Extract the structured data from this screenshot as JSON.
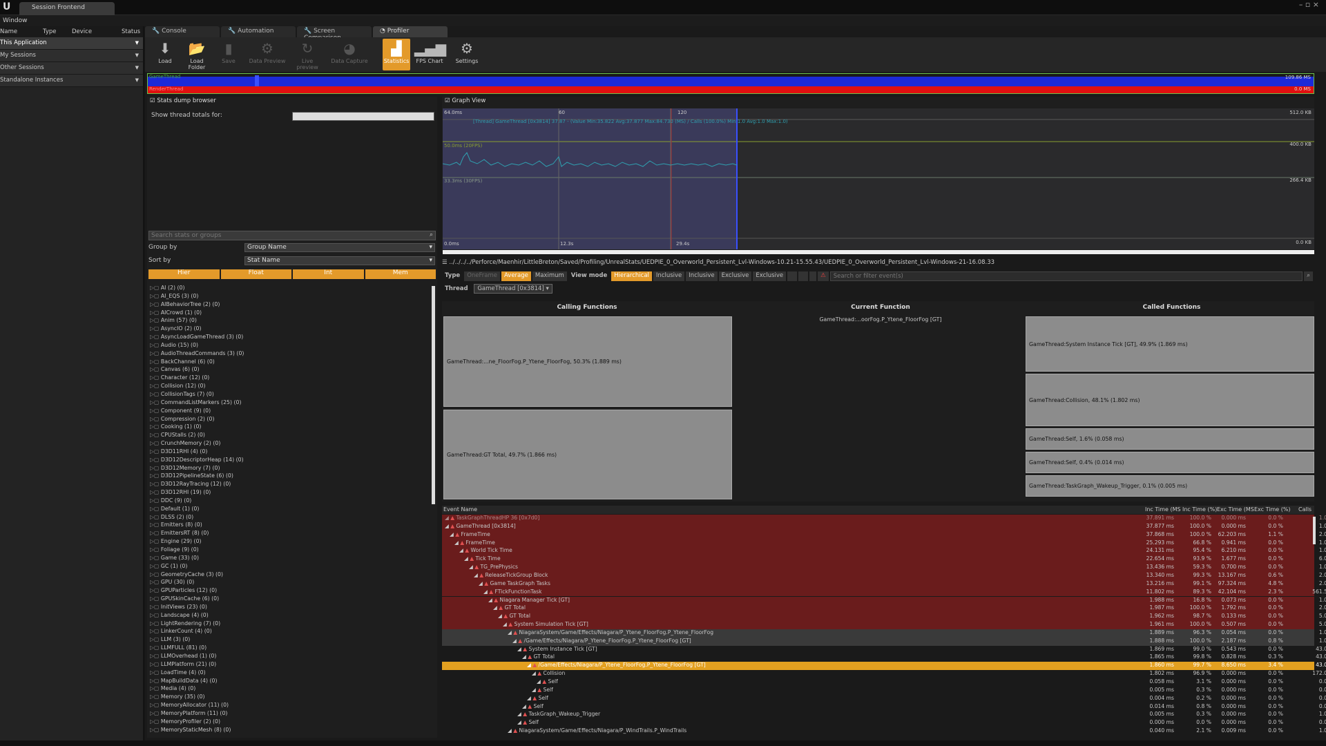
{
  "window": {
    "tab": "Session Frontend",
    "menu": "Window",
    "controls": "– ▫ ×"
  },
  "left": {
    "headers": [
      "Name",
      "Type",
      "Device",
      "Status"
    ],
    "rows": [
      "This Application",
      "My Sessions",
      "Other Sessions",
      "Standalone Instances"
    ]
  },
  "tabs": [
    "Console",
    "Automation",
    "Screen Comparison",
    "Profiler"
  ],
  "toolbar": [
    "Load",
    "Load Folder",
    "Save",
    "Data Preview",
    "Live preview",
    "Data Capture",
    "Statistics",
    "FPS Chart",
    "Settings"
  ],
  "timeline": {
    "label1": "GameThread",
    "label2": "RenderThread",
    "val1": "109.86 MS",
    "val2": "0.0 MS"
  },
  "stats": {
    "header": "Stats dump browser",
    "show_thread": "Show thread totals for:",
    "search_placeholder": "Search stats or groups",
    "group_by_label": "Group by",
    "group_by_value": "Group Name",
    "sort_by_label": "Sort by",
    "sort_by_value": "Stat Name",
    "filters": [
      "Hier",
      "Float",
      "Int",
      "Mem"
    ],
    "groups": [
      "AI (2) (0)",
      "AI_EQS (3) (0)",
      "AIBehaviorTree (2) (0)",
      "AICrowd (1) (0)",
      "Anim (57) (0)",
      "AsyncIO (2) (0)",
      "AsyncLoadGameThread (3) (0)",
      "Audio (15) (0)",
      "AudioThreadCommands (3) (0)",
      "BackChannel (6) (0)",
      "Canvas (6) (0)",
      "Character (12) (0)",
      "Collision (12) (0)",
      "CollisionTags (7) (0)",
      "CommandListMarkers (25) (0)",
      "Component (9) (0)",
      "Compression (2) (0)",
      "Cooking (1) (0)",
      "CPUStalls (2) (0)",
      "CrunchMemory (2) (0)",
      "D3D11RHI (4) (0)",
      "D3D12DescriptorHeap (14) (0)",
      "D3D12Memory (7) (0)",
      "D3D12PipelineState (6) (0)",
      "D3D12RayTracing (12) (0)",
      "D3D12RHI (19) (0)",
      "DDC (9) (0)",
      "Default (1) (0)",
      "DLSS (2) (0)",
      "Emitters (8) (0)",
      "EmittersRT (8) (0)",
      "Engine (29) (0)",
      "Foliage (9) (0)",
      "Game (33) (0)",
      "GC (1) (0)",
      "GeometryCache (3) (0)",
      "GPU (30) (0)",
      "GPUParticles (12) (0)",
      "GPUSkinCache (6) (0)",
      "InitViews (23) (0)",
      "Landscape (4) (0)",
      "LightRendering (7) (0)",
      "LinkerCount (4) (0)",
      "LLM (3) (0)",
      "LLMFULL (81) (0)",
      "LLMOverhead (1) (0)",
      "LLMPlatform (21) (0)",
      "LoadTime (4) (0)",
      "MapBuildData (4) (0)",
      "Media (4) (0)",
      "Memory (35) (0)",
      "MemoryAllocator (11) (0)",
      "MemoryPlatform (11) (0)",
      "MemoryProfiler (2) (0)",
      "MemoryStaticMesh (8) (0)"
    ]
  },
  "graph": {
    "header": "Graph View",
    "top_ms": "64.0ms",
    "x1": "60",
    "x2": "120",
    "r1": "512.0 KB",
    "r2": "400.0 KB",
    "r3": "266.4 KB",
    "r4": "0.0 KB",
    "fps1": "50.0ms (20FPS)",
    "fps2": "33.3ms (30FPS)",
    "bottom": "0.0ms",
    "t1": "12.3s",
    "t2": "29.4s",
    "legend": "[Thread] GameThread [0x3814] 37.87 - (Value Min:35.822 Avg:37.877 Max:84.730 (MS) / Calls (100.0%) Min:1.0 Avg:1.0 Max:1.0)"
  },
  "path": "../../../../Perforce/Maenhir/LittleBreton/Saved/Profiling/UnrealStats/UEDPIE_0_Overworld_Persistent_Lvl-Windows-10.21-15.55.43/UEDPIE_0_Overworld_Persistent_Lvl-Windows-21-16.08.33",
  "typebar": {
    "type": "Type",
    "oneframe": "OneFrame",
    "average": "Average",
    "maximum": "Maximum",
    "viewmode": "View mode",
    "hier": "Hierarchical",
    "b1": "Inclusive",
    "b2": "Inclusive",
    "b3": "Exclusive",
    "b4": "Exclusive",
    "search": "Search or filter event(s)",
    "thread": "Thread",
    "thread_value": "GameThread [0x3814]"
  },
  "callgraph": {
    "calling_hdr": "Calling Functions",
    "current_hdr": "Current Function",
    "called_hdr": "Called Functions",
    "current": "GameThread:...oorFog.P_Ytene_FloorFog [GT]",
    "calling": [
      "GameThread:...ne_FloorFog.P_Ytene_FloorFog, 50.3% (1.889 ms)",
      "GameThread:GT Total, 49.7% (1.866 ms)"
    ],
    "called": [
      "GameThread:System Instance Tick [GT], 49.9% (1.869 ms)",
      "GameThread:Collision, 48.1% (1.802 ms)",
      "GameThread:Self, 1.6% (0.058 ms)",
      "GameThread:Self, 0.4% (0.014 ms)",
      "GameThread:TaskGraph_Wakeup_Trigger, 0.1% (0.005 ms)"
    ]
  },
  "events": {
    "headers": [
      "Event Name",
      "Inc Time (MS",
      "Inc Time (%)",
      "Exc Time (MS",
      "Exc Time (%)",
      "Calls"
    ],
    "rows": [
      [
        "TaskGraphThreadHP 36 [0x7d0]",
        "37.891 ms",
        "100.0 %",
        "0.000 ms",
        "0.0 %",
        "1.0"
      ],
      [
        "GameThread [0x3814]",
        "37.877 ms",
        "100.0 %",
        "0.000 ms",
        "0.0 %",
        "1.0"
      ],
      [
        "FrameTime",
        "37.868 ms",
        "100.0 %",
        "62.203 ms",
        "1.1 %",
        "2.0"
      ],
      [
        "FrameTime",
        "25.293 ms",
        "66.8 %",
        "0.941 ms",
        "0.0 %",
        "1.0"
      ],
      [
        "World Tick Time",
        "24.131 ms",
        "95.4 %",
        "6.210 ms",
        "0.0 %",
        "1.0"
      ],
      [
        "Tick Time",
        "22.654 ms",
        "93.9 %",
        "1.677 ms",
        "0.0 %",
        "6.0"
      ],
      [
        "TG_PrePhysics",
        "13.436 ms",
        "59.3 %",
        "0.700 ms",
        "0.0 %",
        "1.0"
      ],
      [
        "ReleaseTickGroup Block",
        "13.340 ms",
        "99.3 %",
        "13.167 ms",
        "0.6 %",
        "2.0"
      ],
      [
        "Game TaskGraph Tasks",
        "13.216 ms",
        "99.1 %",
        "97.324 ms",
        "4.8 %",
        "2.0"
      ],
      [
        "FTickFunctionTask",
        "11.802 ms",
        "89.3 %",
        "42.104 ms",
        "2.3 %",
        "561.5"
      ],
      [
        "Niagara Manager Tick [GT]",
        "1.988 ms",
        "16.8 %",
        "0.073 ms",
        "0.0 %",
        "1.0"
      ],
      [
        "GT Total",
        "1.987 ms",
        "100.0 %",
        "1.792 ms",
        "0.0 %",
        "2.0"
      ],
      [
        "GT Total",
        "1.962 ms",
        "98.7 %",
        "0.133 ms",
        "0.0 %",
        "5.0"
      ],
      [
        "System Simulation Tick [GT]",
        "1.961 ms",
        "100.0 %",
        "0.507 ms",
        "0.0 %",
        "5.0"
      ],
      [
        "NiagaraSystem/Game/Effects/Niagara/P_Ytene_FloorFog.P_Ytene_FloorFog",
        "1.889 ms",
        "96.3 %",
        "0.054 ms",
        "0.0 %",
        "1.0"
      ],
      [
        "/Game/Effects/Niagara/P_Ytene_FloorFog.P_Ytene_FloorFog [GT]",
        "1.888 ms",
        "100.0 %",
        "2.187 ms",
        "0.8 %",
        "1.0"
      ],
      [
        "System Instance Tick [GT]",
        "1.869 ms",
        "99.0 %",
        "0.543 ms",
        "0.0 %",
        "43.0"
      ],
      [
        "GT Total",
        "1.865 ms",
        "99.8 %",
        "0.828 ms",
        "0.3 %",
        "43.0"
      ],
      [
        "/Game/Effects/Niagara/P_Ytene_FloorFog.P_Ytene_FloorFog [GT]",
        "1.860 ms",
        "99.7 %",
        "8.650 ms",
        "3.4 %",
        "43.0"
      ],
      [
        "Collision",
        "1.802 ms",
        "96.9 %",
        "0.000 ms",
        "0.0 %",
        "172.0"
      ],
      [
        "Self",
        "0.058 ms",
        "3.1 %",
        "0.000 ms",
        "0.0 %",
        "0.0"
      ],
      [
        "Self",
        "0.005 ms",
        "0.3 %",
        "0.000 ms",
        "0.0 %",
        "0.0"
      ],
      [
        "Self",
        "0.004 ms",
        "0.2 %",
        "0.000 ms",
        "0.0 %",
        "0.0"
      ],
      [
        "Self",
        "0.014 ms",
        "0.8 %",
        "0.000 ms",
        "0.0 %",
        "0.0"
      ],
      [
        "TaskGraph_Wakeup_Trigger",
        "0.005 ms",
        "0.3 %",
        "0.000 ms",
        "0.0 %",
        "1.0"
      ],
      [
        "Self",
        "0.000 ms",
        "0.0 %",
        "0.000 ms",
        "0.0 %",
        "0.0"
      ],
      [
        "NiagaraSystem/Game/Effects/Niagara/P_WindTrails.P_WindTrails",
        "0.040 ms",
        "2.1 %",
        "0.009 ms",
        "0.0 %",
        "1.0"
      ]
    ],
    "indent": [
      0,
      0,
      1,
      2,
      3,
      4,
      5,
      6,
      7,
      8,
      9,
      10,
      11,
      12,
      13,
      14,
      15,
      16,
      17,
      18,
      19,
      18,
      17,
      16,
      15,
      15,
      13
    ]
  }
}
